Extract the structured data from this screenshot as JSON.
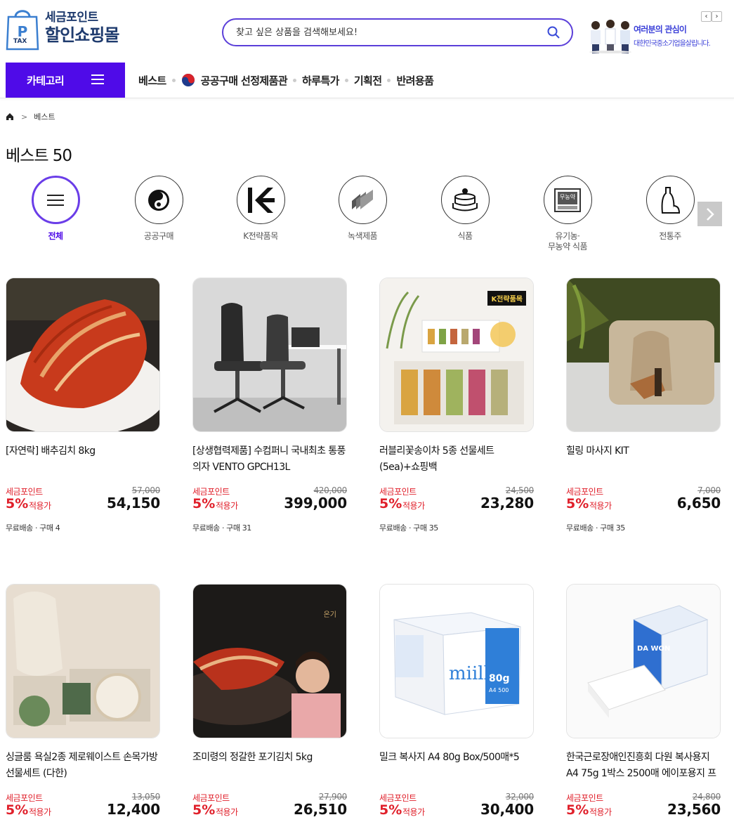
{
  "logo": {
    "badge": "TAX",
    "line1": "세금포인트",
    "line2": "할인쇼핑몰"
  },
  "search": {
    "placeholder": "찾고 싶은 상품을 검색해보세요!"
  },
  "banner": {
    "line1": "여러분의 관심이",
    "line2": "대한민국중소기업을살립니다.",
    "prev": "‹",
    "next": "›"
  },
  "nav": {
    "category_label": "카테고리",
    "links": [
      "베스트",
      "공공구매 선정제품관",
      "하루특가",
      "기획전",
      "반려용품"
    ]
  },
  "breadcrumb": {
    "sep": ">",
    "current": "베스트"
  },
  "page_title": "베스트 50",
  "categories": [
    {
      "label": "전체",
      "icon": "menu-icon"
    },
    {
      "label": "공공구매",
      "icon": "taeguk-icon"
    },
    {
      "label": "K전략품목",
      "icon": "k-strategy-icon"
    },
    {
      "label": "녹색제품",
      "icon": "leaf-icon"
    },
    {
      "label": "식품",
      "icon": "cake-icon"
    },
    {
      "label": "유기농·",
      "label2": "무농약 식품",
      "icon": "organic-icon",
      "badge": "무농약"
    },
    {
      "label": "전통주",
      "icon": "bottle-icon"
    }
  ],
  "price_labels": {
    "points": "세금포인트",
    "apply": "적용가"
  },
  "products": [
    {
      "name": "[자연락] 배추김치 8kg",
      "original": "57,000",
      "pct": "5%",
      "price": "54,150",
      "meta": "무료배송 · 구매 4"
    },
    {
      "name": "[상생협력제품] 수컴퍼니 국내최초 통풍의자 VENTO GPCH13L",
      "original": "420,000",
      "pct": "5%",
      "price": "399,000",
      "meta": "무료배송 · 구매 31"
    },
    {
      "name": "러블리꽃송이차 5종 선물세트(5ea)+쇼핑백",
      "original": "24,500",
      "pct": "5%",
      "price": "23,280",
      "meta": "무료배송 · 구매 35",
      "badge": "K전략품목"
    },
    {
      "name": "힐링 마사지 KIT",
      "original": "7,000",
      "pct": "5%",
      "price": "6,650",
      "meta": "무료배송 · 구매 35"
    },
    {
      "name": "싱글룸 욕실2종 제로웨이스트 손목가방 선물세트 (다한)",
      "original": "13,050",
      "pct": "5%",
      "price": "12,400",
      "meta": ""
    },
    {
      "name": "조미령의 정갈한 포기김치 5kg",
      "original": "27,900",
      "pct": "5%",
      "price": "26,510",
      "meta": "",
      "badge": "온기"
    },
    {
      "name": "밀크 복사지 A4 80g Box/500매*5",
      "original": "32,000",
      "pct": "5%",
      "price": "30,400",
      "meta": "",
      "brand": "miilk",
      "spec": "80g",
      "sub": "A4 500"
    },
    {
      "name": "한국근로장애인진흥회 다원 복사용지 A4 75g 1박스 2500매 에이포용지 프",
      "original": "24,800",
      "pct": "5%",
      "price": "23,560",
      "meta": "",
      "brand": "DA WON"
    }
  ],
  "colors": {
    "accent": "#4f0be8",
    "search_border": "#5b3fd9",
    "sale": "#e0202b",
    "logo": "#1f3b6e"
  }
}
